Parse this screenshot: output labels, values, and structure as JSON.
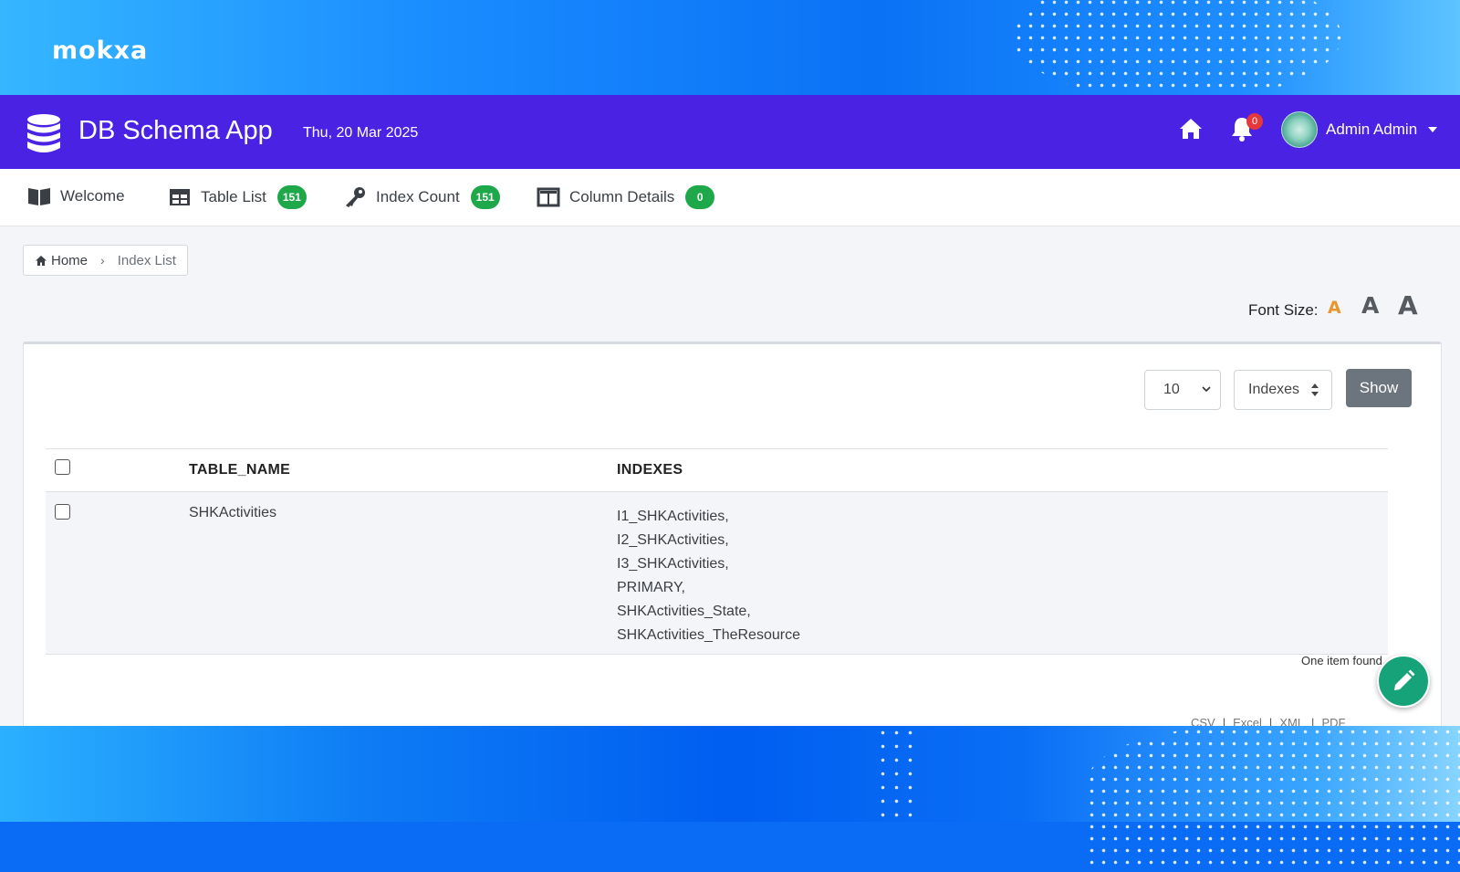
{
  "brand": {
    "logo_text": "mokxa"
  },
  "header": {
    "app_title": "DB Schema App",
    "date": "Thu, 20 Mar 2025",
    "notification_count": "0",
    "user_name": "Admin Admin"
  },
  "nav": {
    "items": [
      {
        "label": "Welcome",
        "icon": "book-icon"
      },
      {
        "label": "Table List",
        "icon": "table-icon",
        "badge": "151"
      },
      {
        "label": "Index Count",
        "icon": "key-icon",
        "badge": "151"
      },
      {
        "label": "Column Details",
        "icon": "columns-icon",
        "badge": "0"
      }
    ]
  },
  "breadcrumb": {
    "home": "Home",
    "current": "Index List"
  },
  "font_size": {
    "label": "Font Size:",
    "small": "A",
    "medium": "A",
    "large": "A"
  },
  "controls": {
    "page_size": "10",
    "view_type": "Indexes",
    "show_button": "Show"
  },
  "table": {
    "columns": [
      "TABLE_NAME",
      "INDEXES"
    ],
    "rows": [
      {
        "table_name": "SHKActivities",
        "indexes": [
          "I1_SHKActivities,",
          "I2_SHKActivities,",
          "I3_SHKActivities,",
          "PRIMARY,",
          "SHKActivities_State,",
          "SHKActivities_TheResource"
        ]
      }
    ],
    "summary": "One item found."
  },
  "export": {
    "csv": "CSV",
    "excel": "Excel",
    "xml": "XML",
    "pdf": "PDF"
  },
  "colors": {
    "header_bg": "#4a22e4",
    "badge_green": "#1ea84a",
    "fab_green": "#17a37a",
    "font_small_orange": "#e8962e"
  }
}
